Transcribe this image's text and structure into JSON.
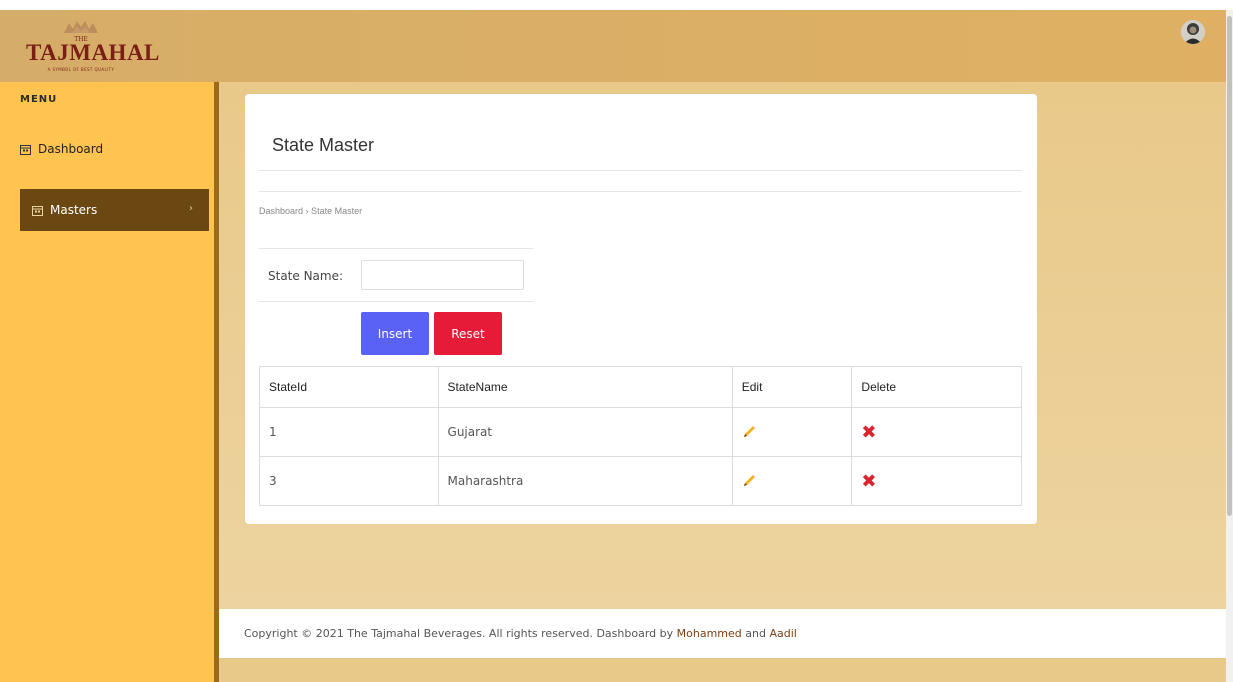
{
  "header": {
    "logo": {
      "the": "THE",
      "brand": "TAJMAHAL",
      "tagline": "A SYMBOL OF BEST QUALITY"
    },
    "avatar_icon": "user-avatar-icon"
  },
  "sidebar": {
    "menu_title": "MENU",
    "items": [
      {
        "label": "Dashboard",
        "icon": "calendar-icon",
        "active": false
      },
      {
        "label": "Masters",
        "icon": "calendar-icon",
        "active": true,
        "chevron": "›"
      }
    ]
  },
  "main": {
    "title": "State Master",
    "breadcrumb": {
      "home": "Dashboard",
      "separator": "›",
      "current": "State Master"
    },
    "form": {
      "state_name_label": "State Name:",
      "state_name_value": "",
      "state_name_placeholder": ""
    },
    "buttons": {
      "insert": "Insert",
      "reset": "Reset"
    },
    "table": {
      "headers": [
        "StateId",
        "StateName",
        "Edit",
        "Delete"
      ],
      "rows": [
        {
          "id": "1",
          "name": "Gujarat"
        },
        {
          "id": "3",
          "name": "Maharashtra"
        }
      ],
      "edit_icon": "pencil-icon",
      "delete_glyph": "✖"
    }
  },
  "footer": {
    "prefix": "Copyright © 2021 The Tajmahal Beverages. All rights reserved. Dashboard by ",
    "author1": "Mohammed",
    "and": " and ",
    "author2": "Aadil"
  },
  "colors": {
    "header": "#dfb064",
    "sidebar": "#ffc450",
    "sidebar_active": "#6b4812",
    "insert_button": "#5a61f5",
    "reset_button": "#e51b37",
    "delete_icon": "#d9232d"
  }
}
